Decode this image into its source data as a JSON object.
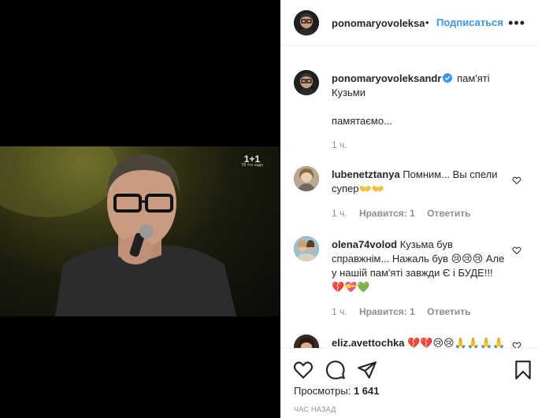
{
  "media": {
    "channel_logo": "1+1",
    "channel_tagline": "ТВ что надо"
  },
  "header": {
    "username": "ponomaryovoleksa",
    "separator": "•",
    "follow_label": "Подписаться",
    "more_label": "•••"
  },
  "caption": {
    "username": "ponomaryovoleksandr",
    "text": "пам'яті Кузьми",
    "text2": "памятаємо...",
    "time": "1 ч."
  },
  "comments": [
    {
      "username": "lubenetztanya",
      "text": "Помним... Вы спели супер👐👐",
      "time": "1 ч.",
      "likes": "Нравится: 1",
      "reply": "Ответить"
    },
    {
      "username": "olena74volod",
      "text": "Кузьма був справжнім... Нажаль був 😢😢😢 Але у нашій пам'яті завжди Є і БУДЕ!!! 💔💝💚",
      "time": "1 ч.",
      "likes": "Нравится: 1",
      "reply": "Ответить"
    },
    {
      "username": "eliz.avettochka",
      "text": "💔💔😢😢🙏🙏🙏🙏🙏🙏"
    }
  ],
  "footer": {
    "views_label": "Просмотры:",
    "views_count": "1 641",
    "timestamp": "час назад"
  },
  "colors": {
    "accent": "#3897f0",
    "text": "#262626",
    "muted": "#8e8e8e"
  }
}
